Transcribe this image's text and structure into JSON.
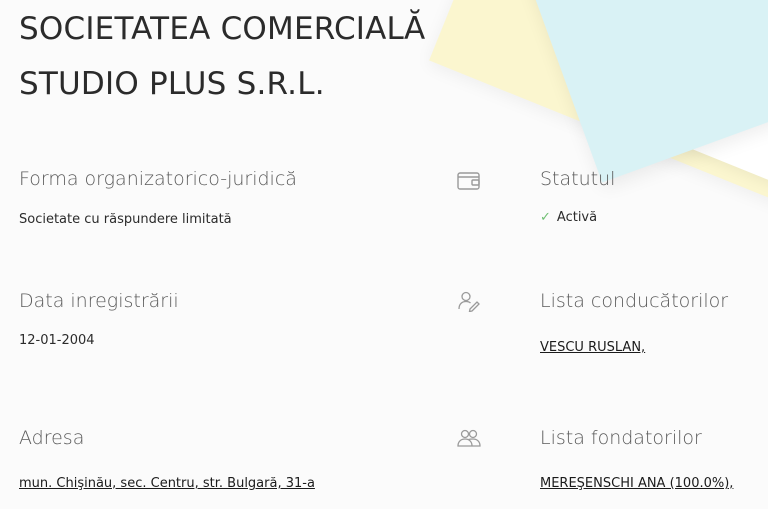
{
  "company": {
    "name": "SOCIETATEA COMERCIALĂ STUDIO PLUS S.R.L."
  },
  "fields": {
    "legal_form": {
      "label": "Forma organizatorico-juridică",
      "value": "Societate cu răspundere limitată"
    },
    "status": {
      "label": "Statutul",
      "value": "Activă"
    },
    "registration_date": {
      "label": "Data inregistrării",
      "value": "12-01-2004"
    },
    "managers": {
      "label": "Lista conducătorilor",
      "value": "VESCU RUSLAN,"
    },
    "address": {
      "label": "Adresa",
      "value": "mun. Chişinău, sec. Centru, str. Bulgară, 31-a"
    },
    "founders": {
      "label": "Lista fondatorilor",
      "value": "MEREŞENSCHI ANA (100.0%),"
    }
  },
  "icons": {
    "status_icon": "wallet-icon",
    "managers_icon": "user-edit-icon",
    "founders_icon": "users-icon",
    "status_check": "check-icon"
  },
  "colors": {
    "status_check": "#6fbf73",
    "icon_stroke": "#9a9a9a"
  }
}
